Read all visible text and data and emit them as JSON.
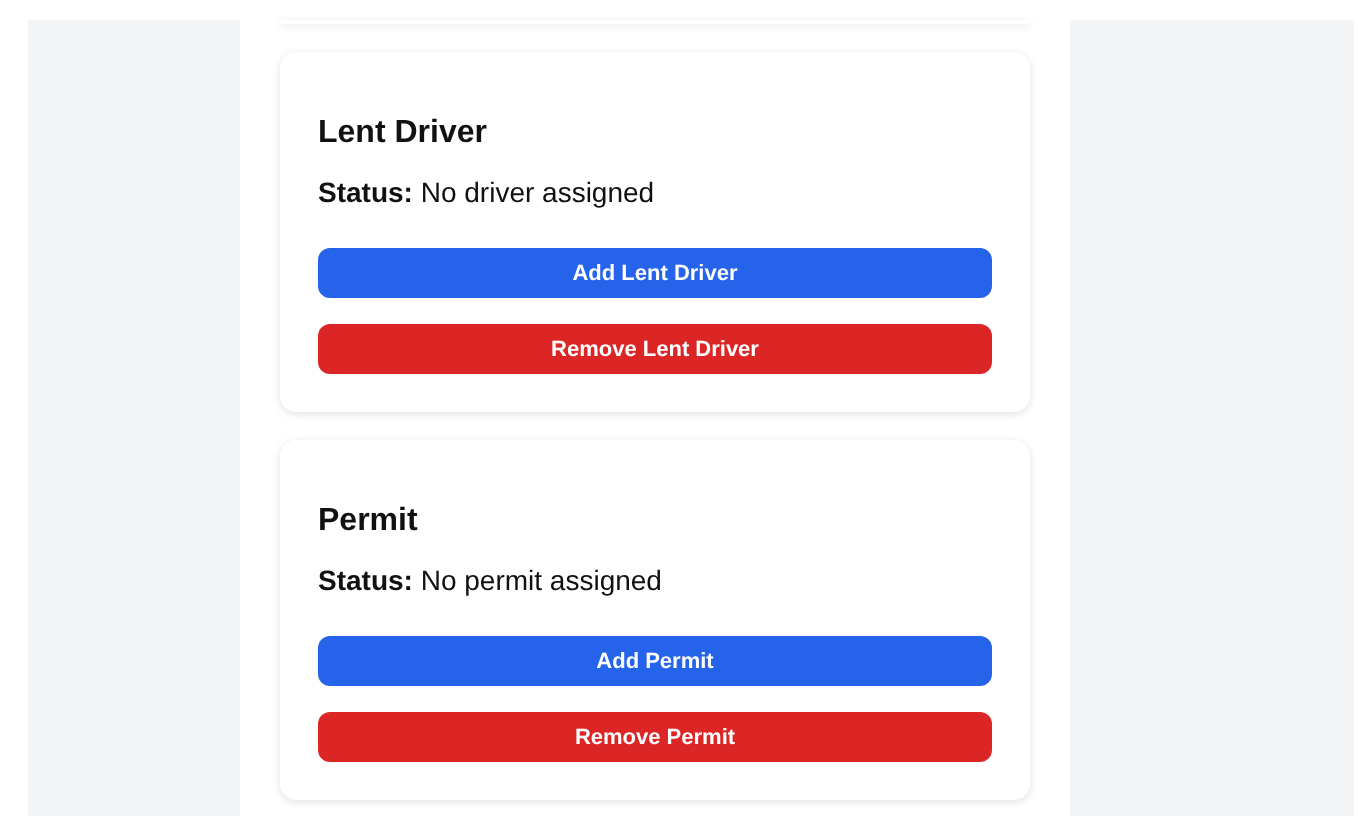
{
  "sections": [
    {
      "title": "Lent Driver",
      "status_label": "Status:",
      "status_value": "No driver assigned",
      "buttons": [
        {
          "label": "Add Lent Driver",
          "kind": "add"
        },
        {
          "label": "Remove Lent Driver",
          "kind": "remove"
        }
      ]
    },
    {
      "title": "Permit",
      "status_label": "Status:",
      "status_value": "No permit assigned",
      "buttons": [
        {
          "label": "Add Permit",
          "kind": "add"
        },
        {
          "label": "Remove Permit",
          "kind": "remove"
        }
      ]
    }
  ]
}
